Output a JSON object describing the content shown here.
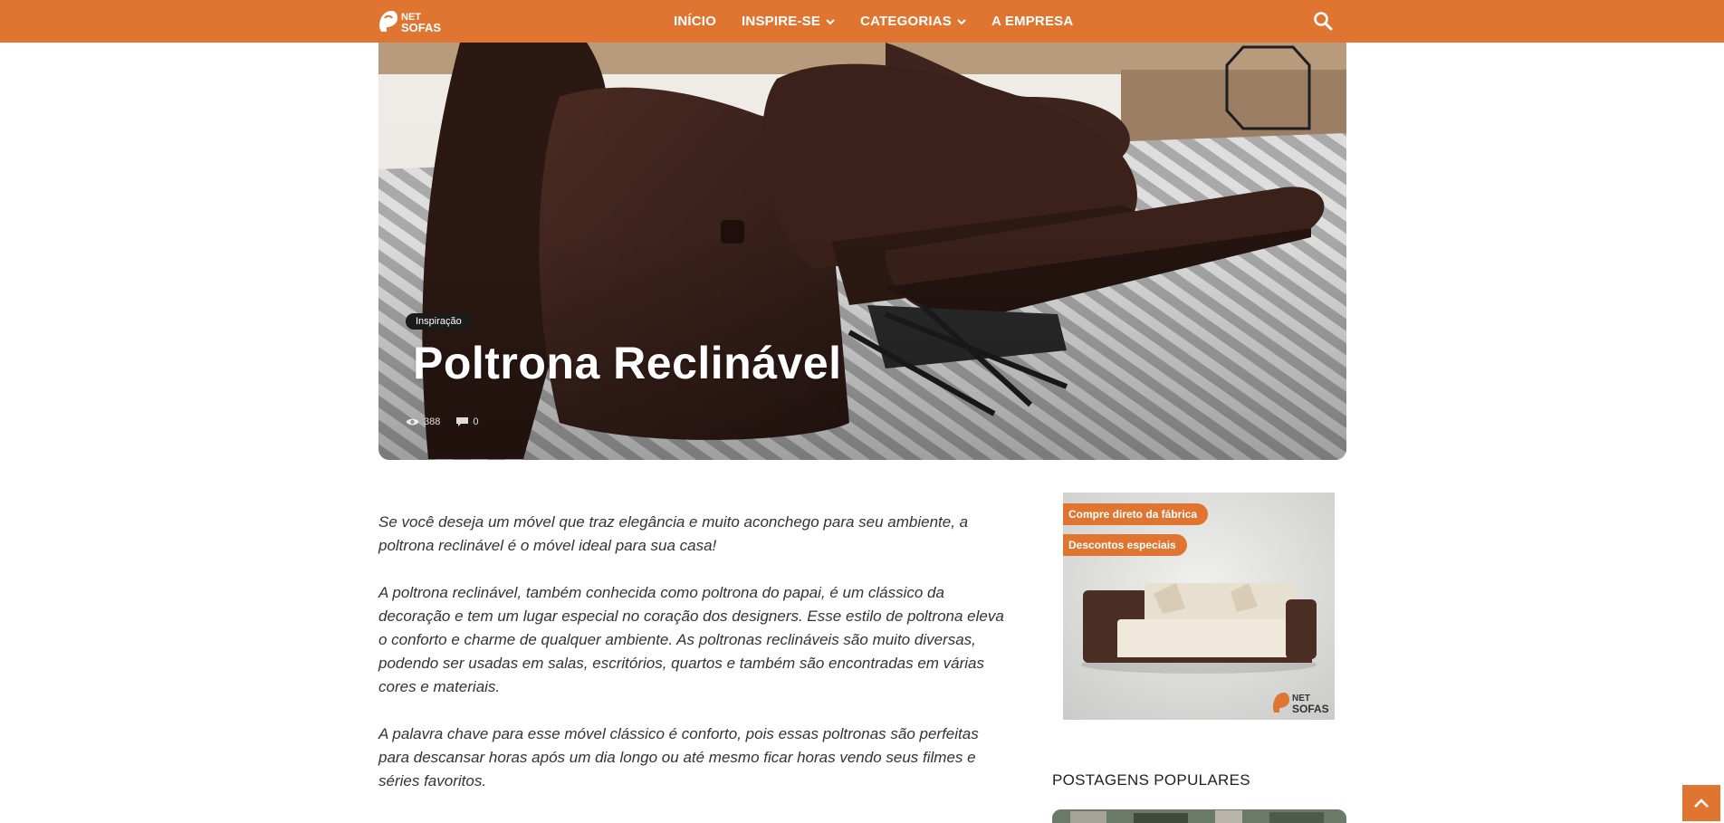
{
  "header": {
    "logo_top": "NET",
    "logo_bottom": "SOFAS",
    "nav": [
      {
        "label": "INÍCIO"
      },
      {
        "label": "INSPIRE-SE"
      },
      {
        "label": "CATEGORIAS"
      },
      {
        "label": "A EMPRESA"
      }
    ]
  },
  "hero": {
    "category": "Inspiração",
    "title": "Poltrona Reclinável",
    "views": "388",
    "comments": "0"
  },
  "article": {
    "paragraphs": [
      "Se você deseja um móvel que traz elegância e muito aconchego para seu ambiente, a poltrona reclinável é o móvel ideal para sua casa!",
      "A poltrona reclinável, também conhecida como poltrona do papai, é um clássico da decoração e tem um lugar especial no coração dos designers. Esse estilo de poltrona eleva o conforto e charme de qualquer ambiente. As poltronas reclináveis são muito diversas, podendo ser usadas em salas, escritórios, quartos e também são encontradas em várias cores e materiais.",
      "A palavra chave para esse móvel clássico é conforto, pois essas poltronas são perfeitas para descansar horas após um dia longo ou até mesmo ficar horas vendo seus filmes e séries favoritos."
    ]
  },
  "sidebar": {
    "ad_tag_1": "Compre direto da fábrica",
    "ad_tag_2": "Descontos especiais",
    "ad_logo_top": "NET",
    "ad_logo_bottom": "SOFAS",
    "popular_title": "POSTAGENS POPULARES"
  },
  "colors": {
    "brand": "#e07531",
    "chair": "#3a221c"
  }
}
